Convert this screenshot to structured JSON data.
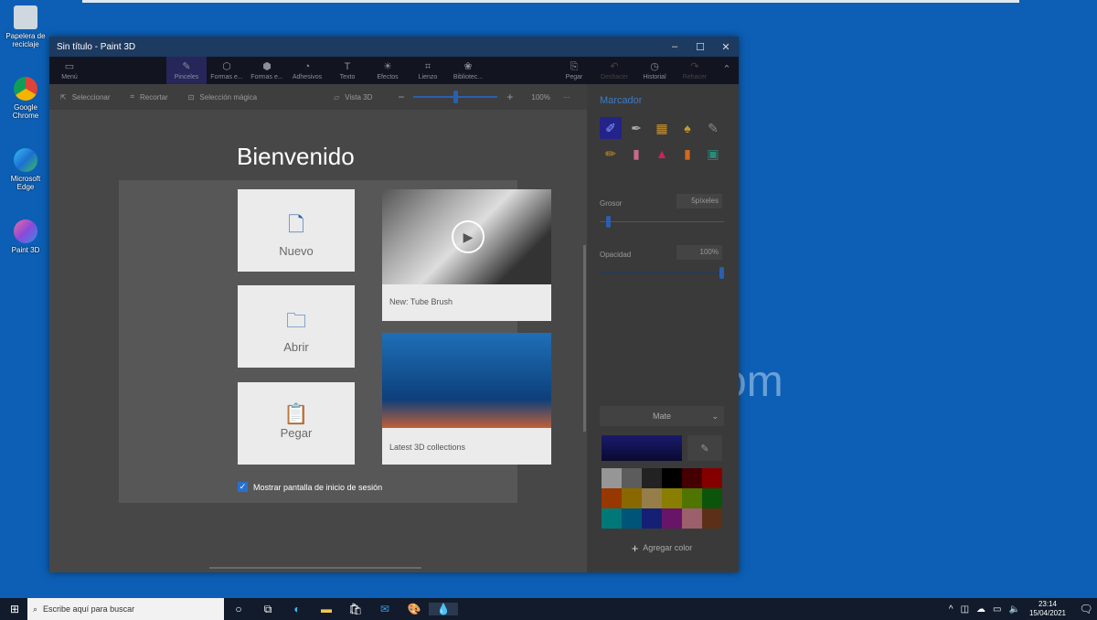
{
  "desktop": {
    "icons": [
      {
        "label": "Papelera de reciclaje",
        "icon": "recycle-bin-icon"
      },
      {
        "label": "Google Chrome",
        "icon": "chrome-icon"
      },
      {
        "label": "Microsoft Edge",
        "icon": "edge-icon"
      },
      {
        "label": "Paint 3D",
        "icon": "paint3d-icon"
      }
    ],
    "watermark": "om"
  },
  "window": {
    "title": "Sin título - Paint 3D",
    "minimize": "–",
    "maximize": "☐",
    "close": "✕"
  },
  "toolbar": {
    "menu": "Menú",
    "items": [
      {
        "label": "Pinceles",
        "icon": "brush-icon",
        "glyph": "✎",
        "active": true
      },
      {
        "label": "Formas e...",
        "icon": "shapes-2d-icon",
        "glyph": "⬡"
      },
      {
        "label": "Formas e...",
        "icon": "shapes-3d-icon",
        "glyph": "⬢"
      },
      {
        "label": "Adhesivos",
        "icon": "sticker-icon",
        "glyph": "◔"
      },
      {
        "label": "Texto",
        "icon": "text-icon",
        "glyph": "T"
      },
      {
        "label": "Efectos",
        "icon": "effects-icon",
        "glyph": "☀"
      },
      {
        "label": "Lienzo",
        "icon": "canvas-icon",
        "glyph": "⌗"
      },
      {
        "label": "Bibliotec...",
        "icon": "library-icon",
        "glyph": "❀"
      }
    ],
    "paste": "Pegar",
    "undo": "Deshacer",
    "history": "Historial",
    "redo": "Rehacer"
  },
  "subbar": {
    "select": "Seleccionar",
    "crop": "Recortar",
    "magic_select": "Selección mágica",
    "view3d": "Vista 3D",
    "zoom": "100%",
    "zoom_value": 50
  },
  "welcome": {
    "title": "Bienvenido",
    "new": "Nuevo",
    "open": "Abrir",
    "paste": "Pegar",
    "media": [
      {
        "caption": "New: Tube Brush"
      },
      {
        "caption": "Latest 3D collections"
      }
    ],
    "show_checkbox": "Mostrar pantalla de inicio de sesión",
    "show_checked": true
  },
  "panel": {
    "title": "Marcador",
    "thickness_label": "Grosor",
    "thickness_value": "5píxeles",
    "thickness_fraction": 0.05,
    "opacity_label": "Opacidad",
    "opacity_value": "100%",
    "opacity_fraction": 1.0,
    "finish": "Mate",
    "current_color": "#1a1a6e",
    "add_color": "Agregar color",
    "palette": [
      "#c8c8c8",
      "#7a7a7a",
      "#2e2e2e",
      "#000000",
      "#5a0000",
      "#b00000",
      "#c84a00",
      "#b88a00",
      "#c8a860",
      "#b8a800",
      "#6a9a00",
      "#107010",
      "#00a0a0",
      "#0070a0",
      "#1a2a9a",
      "#8a1a8a",
      "#d08090",
      "#7a4020"
    ]
  },
  "taskbar": {
    "search_placeholder": "Escribe aquí para buscar",
    "time": "23:14",
    "date": "15/04/2021"
  }
}
